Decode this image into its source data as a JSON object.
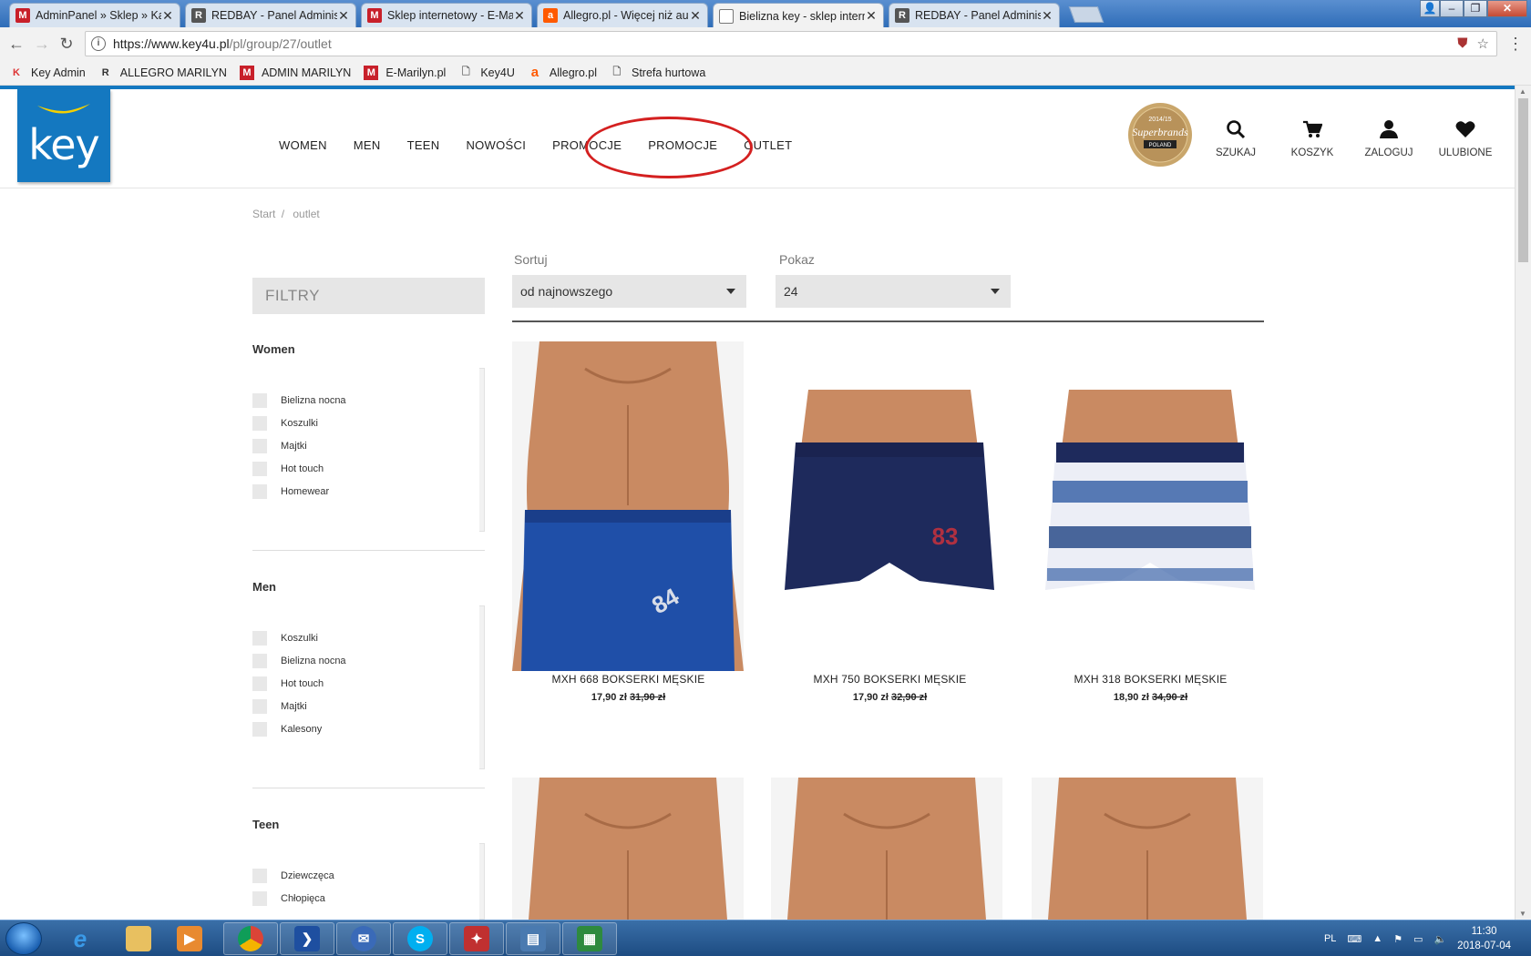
{
  "browser": {
    "tabs": [
      {
        "title": "AdminPanel » Sklep » Kat",
        "favicon": "M",
        "color": "#c8202a",
        "active": false
      },
      {
        "title": "REDBAY - Panel Administ",
        "favicon": "R",
        "color": "#333333",
        "active": false
      },
      {
        "title": "Sklep internetowy - E-Ma",
        "favicon": "M",
        "color": "#c8202a",
        "active": false
      },
      {
        "title": "Allegro.pl - Więcej niż au",
        "favicon": "a",
        "color": "#ff5a00",
        "active": false
      },
      {
        "title": "Bielizna key - sklep intern",
        "favicon": "",
        "color": "#888888",
        "active": true
      },
      {
        "title": "REDBAY - Panel Administ",
        "favicon": "R",
        "color": "#333333",
        "active": false
      }
    ],
    "close_glyph": "✕",
    "url_host": "https://www.key4u.pl",
    "url_path": "/pl/group/27/outlet",
    "bookmarks": [
      {
        "label": "Key Admin",
        "icon": "K",
        "color": "#d33"
      },
      {
        "label": "ALLEGRO MARILYN",
        "icon": "R",
        "color": "#333"
      },
      {
        "label": "ADMIN MARILYN",
        "icon": "M",
        "color": "#c8202a"
      },
      {
        "label": "E-Marilyn.pl",
        "icon": "M",
        "color": "#c8202a"
      },
      {
        "label": "Key4U",
        "icon": "🗋",
        "color": "#666"
      },
      {
        "label": "Allegro.pl",
        "icon": "a",
        "color": "#ff5a00"
      },
      {
        "label": "Strefa hurtowa",
        "icon": "🗋",
        "color": "#666"
      }
    ]
  },
  "header": {
    "logo_text": "key",
    "nav": [
      "WOMEN",
      "MEN",
      "TEEN",
      "NOWOŚCI",
      "PROMOCJE",
      "PROMOCJE",
      "OUTLET"
    ],
    "badge": {
      "years": "2014/15",
      "brand": "Superbrands",
      "country": "POLAND"
    },
    "icons": [
      {
        "label": "SZUKAJ",
        "icon": "search-icon"
      },
      {
        "label": "KOSZYK",
        "icon": "cart-icon"
      },
      {
        "label": "ZALOGUJ",
        "icon": "user-icon"
      },
      {
        "label": "ULUBIONE",
        "icon": "heart-icon"
      }
    ],
    "accent": "#1478c0"
  },
  "breadcrumb": {
    "start": "Start",
    "sep": "/",
    "current": "outlet"
  },
  "filters": {
    "title": "FILTRY",
    "groups": [
      {
        "name": "Women",
        "items": [
          "Bielizna nocna",
          "Koszulki",
          "Majtki",
          "Hot touch",
          "Homewear"
        ]
      },
      {
        "name": "Men",
        "items": [
          "Koszulki",
          "Bielizna nocna",
          "Hot touch",
          "Majtki",
          "Kalesony"
        ]
      },
      {
        "name": "Teen",
        "items": [
          "Dziewczęca",
          "Chłopięca"
        ]
      }
    ]
  },
  "toolbar": {
    "sort_label": "Sortuj",
    "sort_value": "od najnowszego",
    "show_label": "Pokaz",
    "show_value": "24"
  },
  "products": [
    {
      "name": "MXH 668 BOKSERKI MĘSKIE",
      "price": "17,90 zł",
      "old_price": "31,90 zł"
    },
    {
      "name": "MXH 750 BOKSERKI MĘSKIE",
      "price": "17,90 zł",
      "old_price": "32,90 zł"
    },
    {
      "name": "MXH 318 BOKSERKI MĘSKIE",
      "price": "18,90 zł",
      "old_price": "34,90 zł"
    }
  ],
  "taskbar": {
    "lang": "PL",
    "time": "11:30",
    "date": "2018-07-04"
  }
}
